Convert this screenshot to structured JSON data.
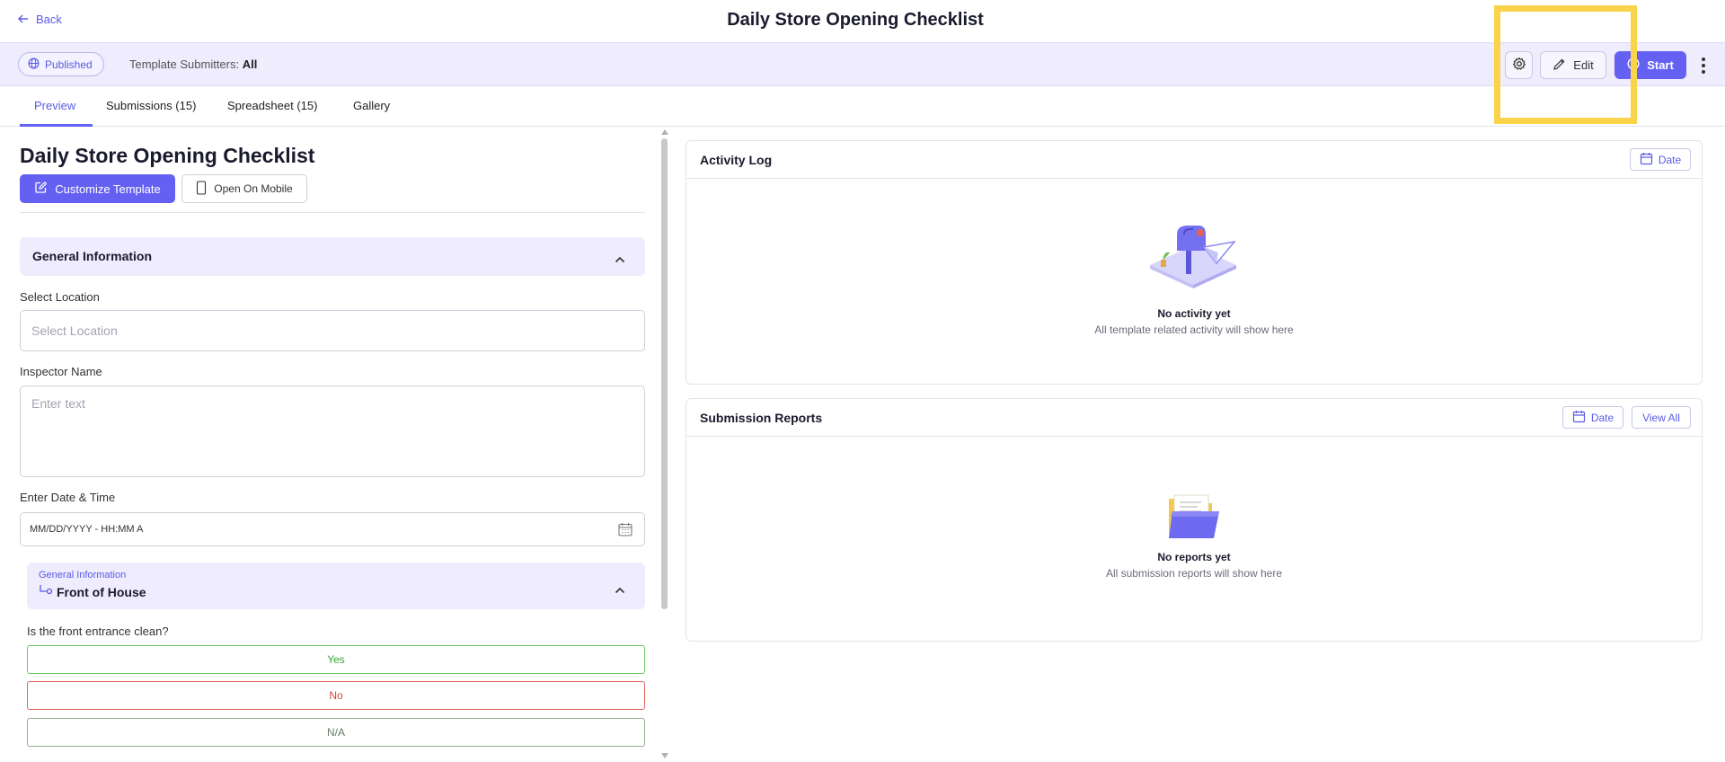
{
  "header": {
    "back_label": "Back",
    "title": "Daily Store Opening Checklist"
  },
  "subbar": {
    "status_badge": "Published",
    "submitters_label": "Template Submitters:",
    "submitters_value": "All",
    "edit_label": "Edit",
    "start_label": "Start"
  },
  "tabs": [
    {
      "label": "Preview",
      "active": true
    },
    {
      "label": "Submissions (15)",
      "active": false
    },
    {
      "label": "Spreadsheet (15)",
      "active": false
    },
    {
      "label": "Gallery",
      "active": false
    }
  ],
  "form": {
    "title": "Daily Store Opening Checklist",
    "customize_label": "Customize Template",
    "mobile_label": "Open On Mobile",
    "section": "General Information",
    "fields": {
      "location": {
        "label": "Select Location",
        "placeholder": "Select Location"
      },
      "inspector": {
        "label": "Inspector Name",
        "placeholder": "Enter text"
      },
      "datetime": {
        "label": "Enter Date & Time",
        "value": "MM/DD/YYYY - HH:MM A"
      }
    },
    "sub_section": {
      "parent": "General Information",
      "name": "Front of House"
    },
    "question": "Is the front entrance clean?",
    "choices": [
      "Yes",
      "No",
      "N/A"
    ]
  },
  "activity_log": {
    "title": "Activity Log",
    "date_label": "Date",
    "empty_title": "No activity yet",
    "empty_sub": "All template related activity will show here"
  },
  "submission_reports": {
    "title": "Submission Reports",
    "date_label": "Date",
    "view_all_label": "View All",
    "empty_title": "No reports yet",
    "empty_sub": "All submission reports will show here"
  },
  "colors": {
    "accent": "#6461f2",
    "accent_light": "#eeecfd",
    "highlight": "#f9d34a",
    "yes": "#3aa53a",
    "no": "#d8453f"
  }
}
